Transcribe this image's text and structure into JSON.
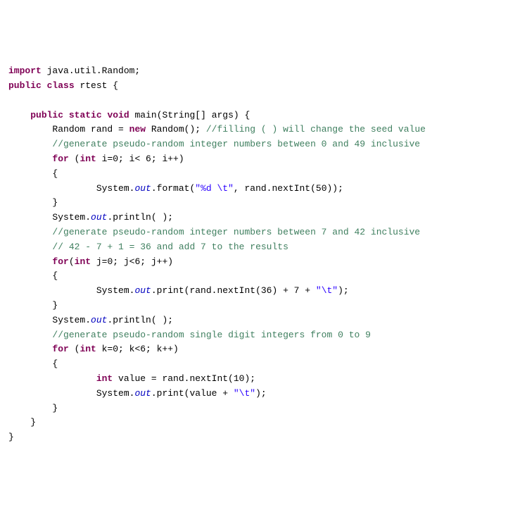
{
  "code": {
    "l01": {
      "t1": "import",
      "t2": " java.util.Random;"
    },
    "l02": {
      "t1": "public",
      "t2": " ",
      "t3": "class",
      "t4": " rtest {"
    },
    "l03": "",
    "l04": {
      "t1": "    ",
      "t2": "public",
      "t3": " ",
      "t4": "static",
      "t5": " ",
      "t6": "void",
      "t7": " main(String[] args) {"
    },
    "l05": {
      "t1": "        Random rand = ",
      "t2": "new",
      "t3": " Random(); ",
      "t4": "//filling ( ) will change the seed value"
    },
    "l06": {
      "t1": "        ",
      "t2": "//generate pseudo-random integer numbers between 0 and 49 inclusive"
    },
    "l07": {
      "t1": "        ",
      "t2": "for",
      "t3": " (",
      "t4": "int",
      "t5": " i=0; i< 6; i++)"
    },
    "l08": "        {",
    "l09": {
      "t1": "                System.",
      "t2": "out",
      "t3": ".format(",
      "t4": "\"%d \\t\"",
      "t5": ", rand.nextInt(50));"
    },
    "l10": "        }",
    "l11": {
      "t1": "        System.",
      "t2": "out",
      "t3": ".println( );"
    },
    "l12": {
      "t1": "        ",
      "t2": "//generate pseudo-random integer numbers between 7 and 42 inclusive"
    },
    "l13": {
      "t1": "        ",
      "t2": "// 42 - 7 + 1 = 36 and add 7 to the results"
    },
    "l14": {
      "t1": "        ",
      "t2": "for",
      "t3": "(",
      "t4": "int",
      "t5": " j=0; j<6; j++)"
    },
    "l15": "        {",
    "l16": {
      "t1": "                System.",
      "t2": "out",
      "t3": ".print(rand.nextInt(36) + 7 + ",
      "t4": "\"\\t\"",
      "t5": ");"
    },
    "l17": "        }",
    "l18": {
      "t1": "        System.",
      "t2": "out",
      "t3": ".println( );"
    },
    "l19": {
      "t1": "        ",
      "t2": "//generate pseudo-random single digit integers from 0 to 9"
    },
    "l20": {
      "t1": "        ",
      "t2": "for",
      "t3": " (",
      "t4": "int",
      "t5": " k=0; k<6; k++)"
    },
    "l21": "        {",
    "l22": {
      "t1": "                ",
      "t2": "int",
      "t3": " value = rand.nextInt(10);"
    },
    "l23": {
      "t1": "                System.",
      "t2": "out",
      "t3": ".print(value + ",
      "t4": "\"\\t\"",
      "t5": ");"
    },
    "l24": "        }",
    "l25": "    }",
    "l26": "}"
  }
}
